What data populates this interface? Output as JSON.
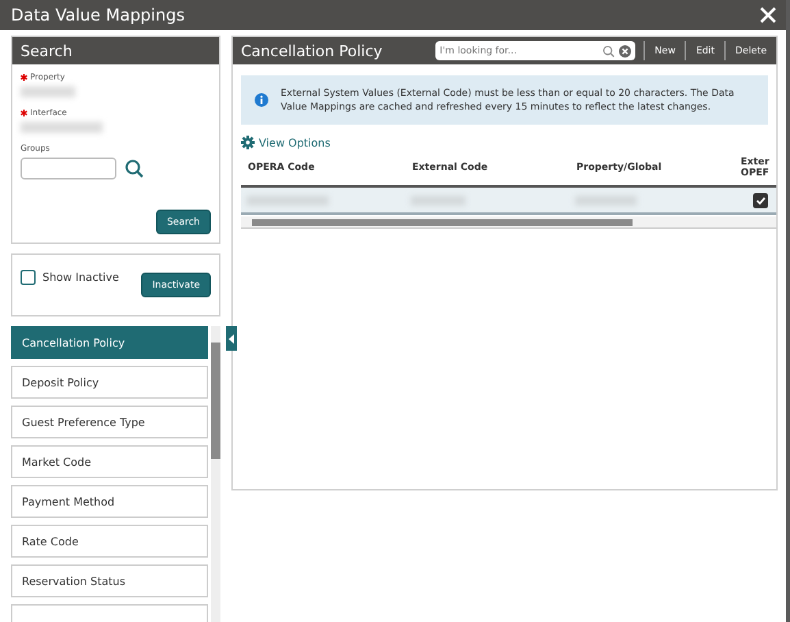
{
  "window": {
    "title": "Data Value Mappings"
  },
  "search_panel": {
    "title": "Search",
    "fields": [
      {
        "label": "Property",
        "required": true
      },
      {
        "label": "Interface",
        "required": true
      }
    ],
    "groups_label": "Groups",
    "search_button": "Search"
  },
  "filter": {
    "show_inactive": {
      "label": "Show Inactive",
      "checked": false
    },
    "inactivate_button": "Inactivate"
  },
  "mapping_types": [
    {
      "label": "Cancellation Policy",
      "selected": true
    },
    {
      "label": "Deposit Policy",
      "selected": false
    },
    {
      "label": "Guest Preference Type",
      "selected": false
    },
    {
      "label": "Market Code",
      "selected": false
    },
    {
      "label": "Payment Method",
      "selected": false
    },
    {
      "label": "Rate Code",
      "selected": false
    },
    {
      "label": "Reservation Status",
      "selected": false
    }
  ],
  "main_panel": {
    "title": "Cancellation Policy",
    "search_placeholder": "I'm looking for...",
    "actions": [
      "New",
      "Edit",
      "Delete"
    ],
    "info": "External System Values (External Code) must be less than or equal to 20 characters. The Data Value Mappings are cached and refreshed every 15 minutes to reflect the latest changes.",
    "view_options": "View Options",
    "table": {
      "columns": [
        [
          "OPERA Code"
        ],
        [
          "External Code"
        ],
        [
          "Property/Global"
        ],
        [
          "Exter",
          "OPEF"
        ]
      ],
      "rows": [
        {
          "checked": true
        }
      ]
    }
  }
}
